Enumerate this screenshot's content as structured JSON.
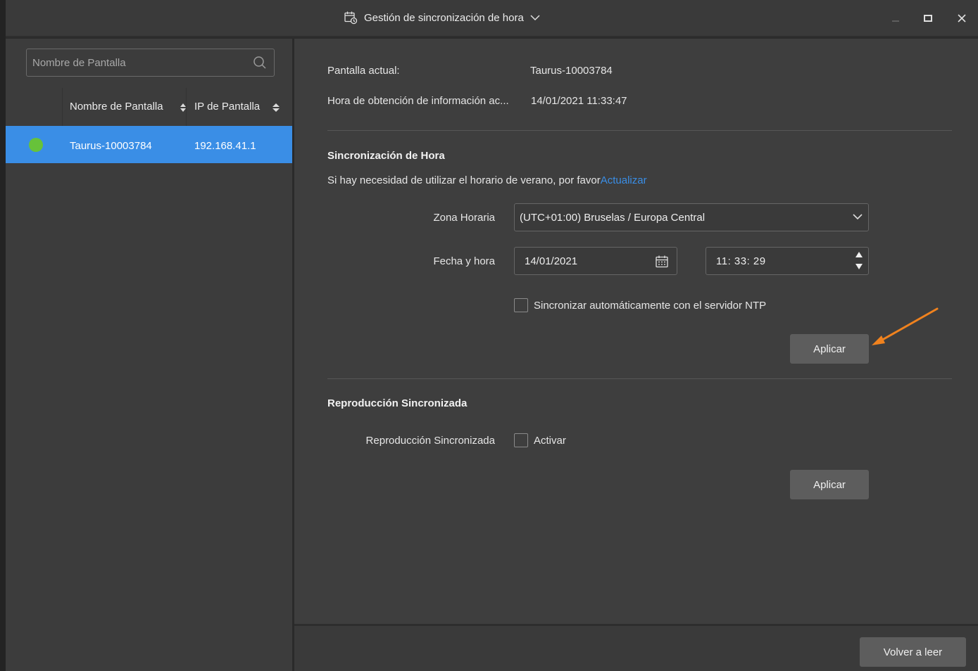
{
  "window": {
    "title": "Gestión de sincronización de hora",
    "controls": [
      "minimize-icon",
      "maximize-icon",
      "close-icon"
    ]
  },
  "sidebar": {
    "search": {
      "placeholder": "Nombre de Pantalla"
    },
    "columns": [
      "Nombre de Pantalla",
      "IP de Pantalla"
    ],
    "rows": [
      {
        "status": "online",
        "name": "Taurus-10003784",
        "ip": "192.168.41.1"
      }
    ]
  },
  "info": {
    "current_screen_label": "Pantalla actual:",
    "current_screen_value": "Taurus-10003784",
    "fetch_time_label": "Hora de obtención de información ac...",
    "fetch_time_value": "14/01/2021 11:33:47"
  },
  "time_sync": {
    "heading": "Sincronización de Hora",
    "dst_note": "Si hay necesidad de utilizar el horario de verano, por favor",
    "dst_link": "Actualizar",
    "timezone_label": "Zona Horaria",
    "timezone_value": "(UTC+01:00) Bruselas / Europa Central",
    "datetime_label": "Fecha y hora",
    "date_value": "14/01/2021",
    "time_value": "11: 33: 29",
    "ntp_label": "Sincronizar automáticamente con el servidor NTP",
    "ntp_checked": false,
    "apply_label": "Aplicar"
  },
  "sync_playback": {
    "heading": "Reproducción Sincronizada",
    "field_label": "Reproducción Sincronizada",
    "enable_label": "Activar",
    "enable_checked": false,
    "apply_label": "Aplicar"
  },
  "footer": {
    "reload_label": "Volver a leer"
  },
  "colors": {
    "accent": "#3a8ee6",
    "online": "#67c23a",
    "annotation_arrow": "#f0821e"
  }
}
